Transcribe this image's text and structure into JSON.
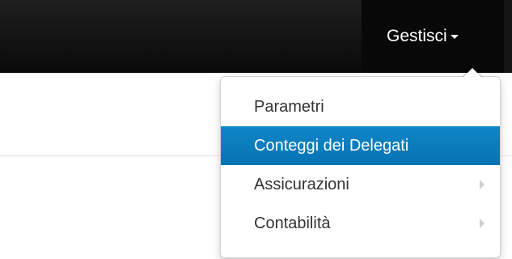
{
  "navbar": {
    "manage_menu": {
      "label": "Gestisci"
    }
  },
  "dropdown": {
    "items": [
      {
        "label": "Parametri",
        "active": false,
        "has_submenu": false
      },
      {
        "label": "Conteggi dei Delegati",
        "active": true,
        "has_submenu": false
      },
      {
        "label": "Assicurazioni",
        "active": false,
        "has_submenu": true
      },
      {
        "label": "Contabilità",
        "active": false,
        "has_submenu": true
      }
    ]
  },
  "colors": {
    "navbar_bg": "#111111",
    "active_item_bg": "#0a7cbd",
    "text": "#333333"
  }
}
